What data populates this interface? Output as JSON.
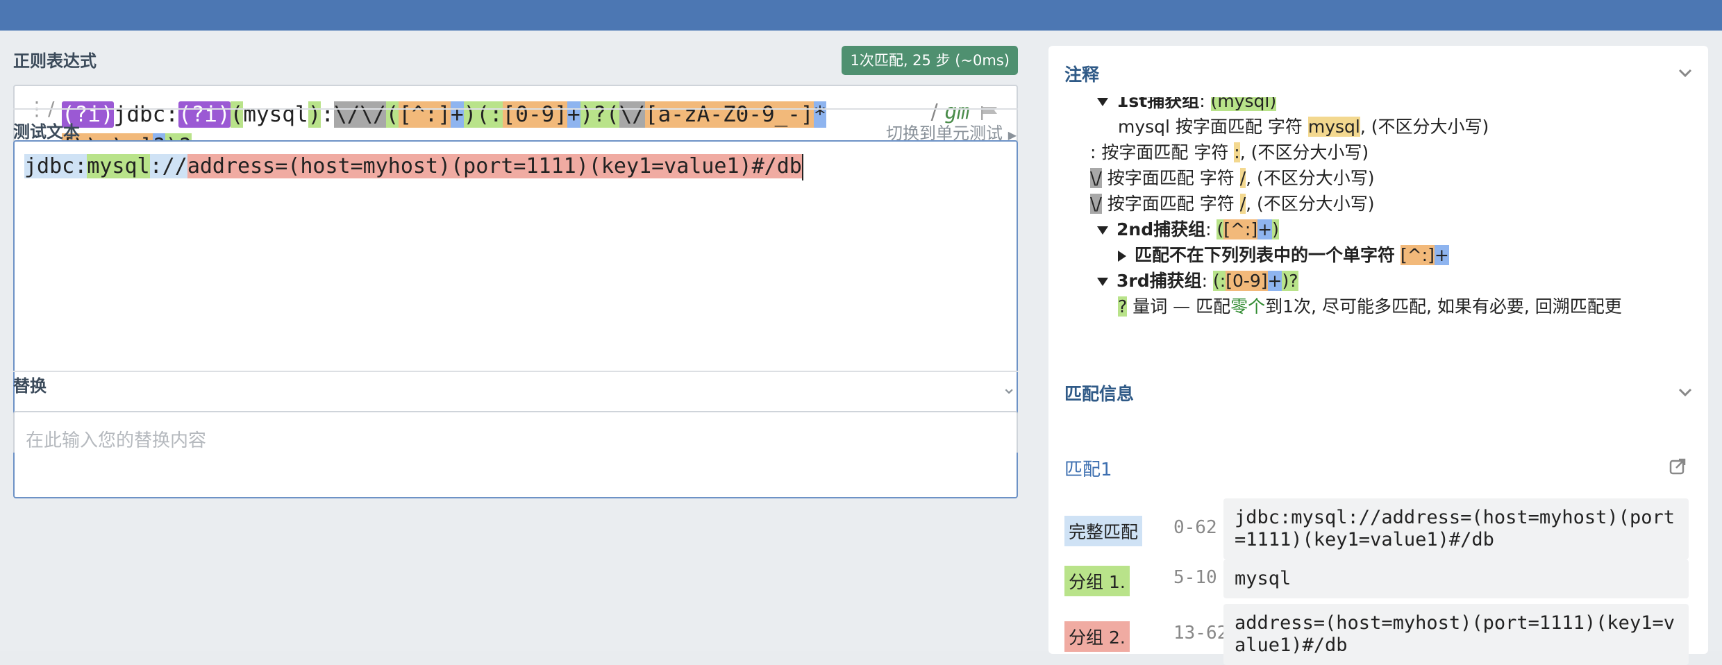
{
  "regex_section": {
    "title": "正则表达式",
    "match_badge": "1次匹配, 25 步 (~0ms)",
    "delimiter_left": "/",
    "tokens": [
      {
        "t": "(?i)",
        "k": "flag"
      },
      {
        "t": "jdbc:",
        "k": "lit"
      },
      {
        "t": "(?i)",
        "k": "flag"
      },
      {
        "t": "(",
        "k": "grp"
      },
      {
        "t": "mysql",
        "k": "lit"
      },
      {
        "t": ")",
        "k": "grp"
      },
      {
        "t": ":",
        "k": "lit"
      },
      {
        "t": "\\/\\/",
        "k": "esc"
      },
      {
        "t": "(",
        "k": "grp"
      },
      {
        "t": "[^:]",
        "k": "cls"
      },
      {
        "t": "+",
        "k": "q"
      },
      {
        "t": ")",
        "k": "grp"
      },
      {
        "t": "(:",
        "k": "grp"
      },
      {
        "t": "[0-9]",
        "k": "cls"
      },
      {
        "t": "+",
        "k": "q"
      },
      {
        "t": ")?",
        "k": "grp"
      },
      {
        "t": "(",
        "k": "grp"
      },
      {
        "t": "\\/",
        "k": "esc"
      },
      {
        "t": "[a-zA-Z0-9_-]",
        "k": "cls"
      },
      {
        "t": "*",
        "k": "q"
      },
      {
        "t": "[\\\\.\\-]",
        "k": "cls"
      },
      {
        "t": "?",
        "k": "q"
      },
      {
        "t": ")?",
        "k": "grp"
      }
    ],
    "delimiter_right": "/",
    "flags": "gm",
    "flag_icon": "flag-icon"
  },
  "test_section": {
    "title": "测试文本",
    "switch_link": "切换到单元测试",
    "parts": [
      {
        "t": "jdbc:",
        "k": "full"
      },
      {
        "t": "mysql",
        "k": "g1"
      },
      {
        "t": "://",
        "k": "full"
      },
      {
        "t": "address=(host=myhost)(port=1111)(key1=value1)#/db",
        "k": "g2"
      }
    ]
  },
  "replace_section": {
    "title": "替换",
    "placeholder": "在此输入您的替换内容"
  },
  "explanation": {
    "title": "注释",
    "lines": [
      {
        "html": "<b>1st捕获组</b>: <span class=\"hl-grp\">(mysql)</span>",
        "tri": "down"
      },
      {
        "html": "mysql 按字面匹配 字符 <span class=\"hl-lit\">mysql</span>, (不区分大小写)",
        "tri": ""
      },
      {
        "html": ": 按字面匹配 字符 <span class=\"hl-lit\">:</span>, (不区分大小写)",
        "tri": ""
      },
      {
        "html": "<span class=\"hl-esc\">\\/</span> 按字面匹配 字符 <span class=\"hl-lit\">/</span>, (不区分大小写)",
        "tri": ""
      },
      {
        "html": "<span class=\"hl-esc\">\\/</span> 按字面匹配 字符 <span class=\"hl-lit\">/</span>, (不区分大小写)",
        "tri": ""
      },
      {
        "html": "<b>2nd捕获组</b>: <span class=\"hl-grp\">(<span class=\"hl-cls\">[^:]</span><span class=\"hl-q\">+</span>)</span>",
        "tri": "down"
      },
      {
        "html": "<b>匹配不在下列列表中的一个单字符</b> <span class=\"hl-cls\">[^:]</span><span class=\"hl-q\">+</span>",
        "tri": "right"
      },
      {
        "html": "<b>3rd捕获组</b>: <span class=\"hl-grp\">(:<span class=\"hl-cls\">[0-9]</span><span class=\"hl-q\">+</span>)?</span>",
        "tri": "down"
      },
      {
        "html": "<span class=\"hl-grp\">?</span> 量词 — 匹配<span class=\"zero\">零个</span>到1次, 尽可能多匹配, 如果有必要, 回溯匹配更",
        "tri": ""
      }
    ]
  },
  "match_info": {
    "title": "匹配信息",
    "match_label": "匹配1",
    "rows": [
      {
        "tag": "完整匹配",
        "range": "0-62",
        "value": "jdbc:mysql://address=(host=myhost)(port=1111)(key1=value1)#/db",
        "color": "#cfe2f5"
      },
      {
        "tag": "分组 1.",
        "range": "5-10",
        "value": "mysql",
        "color": "#b9e38a"
      },
      {
        "tag": "分组 2.",
        "range": "13-62",
        "value": "address=(host=myhost)(port=1111)(key1=value1)#/db",
        "color": "#f0aba2"
      }
    ]
  }
}
